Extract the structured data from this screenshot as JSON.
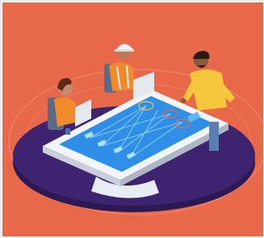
{
  "scene": {
    "description_name": "isometric-team-collaboration",
    "colors": {
      "background": "#E8684A",
      "platform": "#3E2470",
      "platform_edge": "#2C1852",
      "table_frame": "#F2F4F8",
      "screen": "#2F8FE8",
      "screen_glow": "#7FD3FF",
      "shirt_yellow": "#F4C63B",
      "vest_orange": "#F08A2B",
      "helmet": "#F2F2F2"
    },
    "figures": [
      "woman-seated-left",
      "worker-with-hardhat",
      "man-standing-right"
    ]
  }
}
